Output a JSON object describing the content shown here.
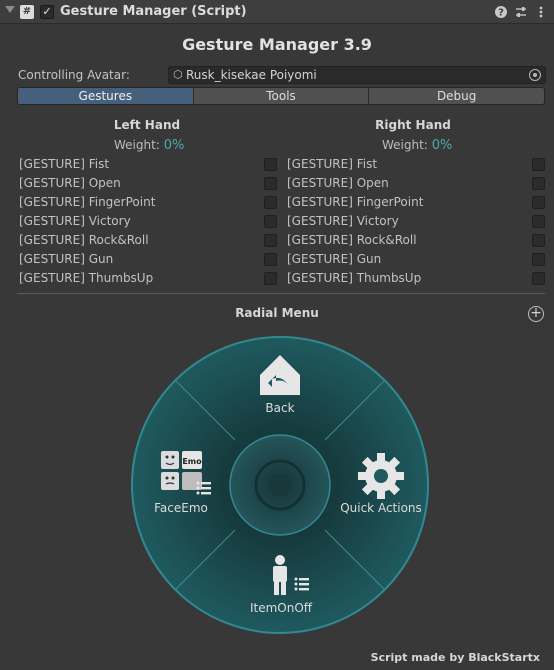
{
  "component": {
    "title": "Gesture Manager (Script)",
    "enabled_mark": "✓",
    "script_icon": "#",
    "header_icons": [
      "help-icon",
      "presets-icon",
      "more-icon"
    ]
  },
  "app": {
    "title": "Gesture Manager 3.9",
    "avatar_label": "Controlling Avatar:",
    "avatar_value": "Rusk_kisekae Poiyomi"
  },
  "tabs": [
    {
      "label": "Gestures",
      "active": true
    },
    {
      "label": "Tools",
      "active": false
    },
    {
      "label": "Debug",
      "active": false
    }
  ],
  "left_hand": {
    "title": "Left Hand",
    "weight_label": "Weight:",
    "weight_value": "0%",
    "gestures": [
      "[GESTURE] Fist",
      "[GESTURE] Open",
      "[GESTURE] FingerPoint",
      "[GESTURE] Victory",
      "[GESTURE] Rock&Roll",
      "[GESTURE] Gun",
      "[GESTURE] ThumbsUp"
    ]
  },
  "right_hand": {
    "title": "Right Hand",
    "weight_label": "Weight:",
    "weight_value": "0%",
    "gestures": [
      "[GESTURE] Fist",
      "[GESTURE] Open",
      "[GESTURE] FingerPoint",
      "[GESTURE] Victory",
      "[GESTURE] Rock&Roll",
      "[GESTURE] Gun",
      "[GESTURE] ThumbsUp"
    ]
  },
  "radial": {
    "title": "Radial Menu",
    "add_symbol": "+",
    "items": [
      {
        "label": "Back",
        "icon": "back-home-icon"
      },
      {
        "label": "Quick Actions",
        "icon": "gear-icon"
      },
      {
        "label": "ItemOnOff",
        "icon": "person-submenu-icon"
      },
      {
        "label": "FaceEmo",
        "icon": "faceemo-submenu-icon",
        "badge": "Emo"
      }
    ],
    "colors": {
      "ring": "#1c4f54",
      "ring_border": "#2f8a92",
      "center": "#1d474b"
    }
  },
  "footer": {
    "credit": "Script made by BlackStartx"
  }
}
